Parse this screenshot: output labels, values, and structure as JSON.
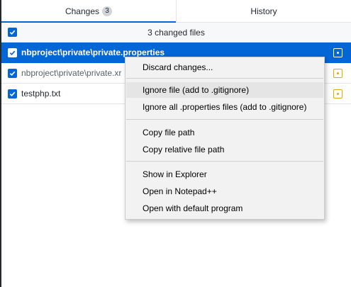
{
  "tabs": [
    {
      "label": "Changes",
      "count": "3"
    },
    {
      "label": "History"
    }
  ],
  "changes_header": {
    "summary": "3 changed files"
  },
  "files": [
    {
      "dir": "nbproject\\private\\",
      "name": "private.properties",
      "full": "nbproject\\private\\private.properties"
    },
    {
      "dir": "nbproject\\private\\",
      "name": "private.xml",
      "visible": "nbproject\\private\\private.xr"
    },
    {
      "dir": "",
      "name": "testphp.txt"
    }
  ],
  "context_menu": {
    "items": [
      "Discard changes...",
      "Ignore file (add to .gitignore)",
      "Ignore all .properties files (add to .gitignore)",
      "Copy file path",
      "Copy relative file path",
      "Show in Explorer",
      "Open in Notepad++",
      "Open with default program"
    ]
  },
  "colors": {
    "accent": "#0366d6",
    "modified": "#dbab09",
    "menu_bg": "#f2f2f2",
    "menu_hover": "#e5e5e5"
  }
}
